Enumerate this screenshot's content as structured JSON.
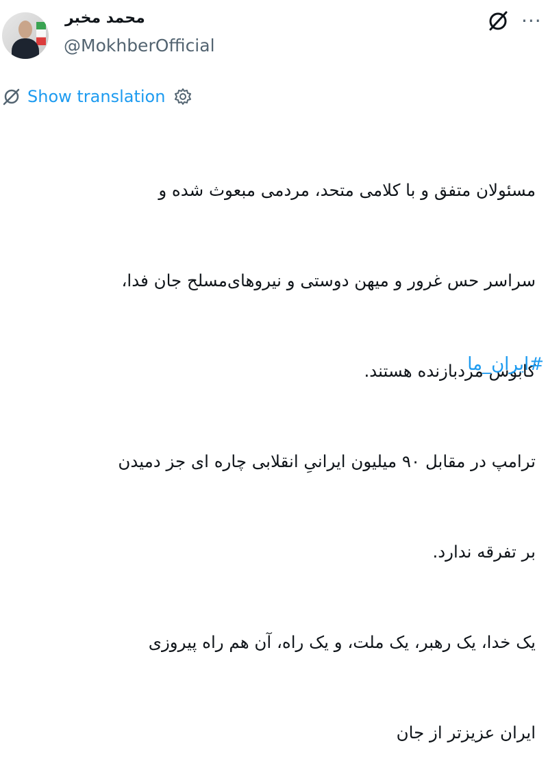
{
  "author": {
    "display_name": "محمد مخبر",
    "handle": "@MokhberOfficial"
  },
  "actions": {
    "grok_icon": "grok-icon",
    "more_label": "···"
  },
  "translation": {
    "label": "Show translation"
  },
  "tweet": {
    "lines": [
      "مسئولان متفق و با کلامی متحد، مردمی مبعوث شده و",
      "سراسر حس غرور و میهن دوستی و نیروهای‌مسلح جان فدا،",
      "کابوس مردبازنده هستند.",
      "ترامپ در مقابل ۹۰ میلیون ایرانیِ انقلابی چاره ای جز دمیدن",
      "بر تفرقه ندارد.",
      "یک خدا، یک رهبر، یک ملت، و یک راه، آن هم راه پیروزی",
      "ایران عزیزتر از جان"
    ],
    "hashtag": "#ایران_ما"
  }
}
